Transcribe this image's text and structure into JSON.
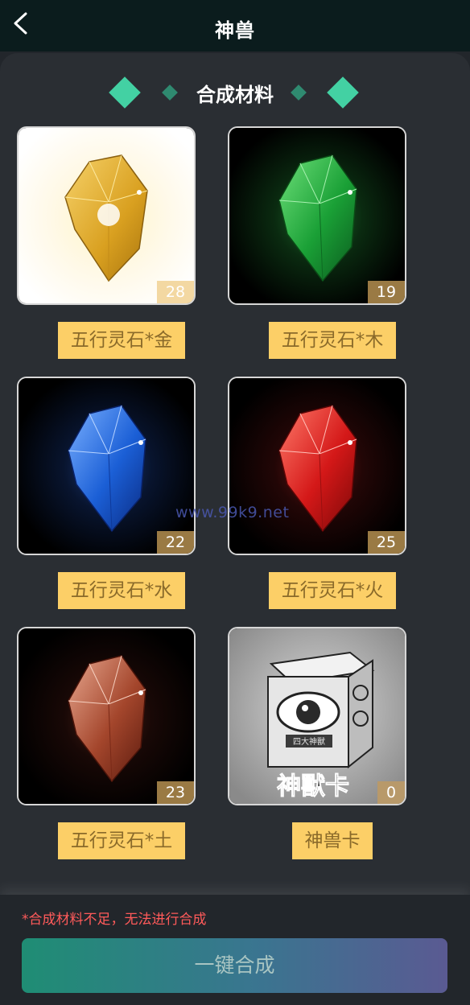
{
  "header": {
    "title": "神兽"
  },
  "section": {
    "title": "合成材料"
  },
  "materials": [
    {
      "name": "五行灵石*金",
      "count": "28",
      "color": "#e8b530"
    },
    {
      "name": "五行灵石*木",
      "count": "19",
      "color": "#1fa83c"
    },
    {
      "name": "五行灵石*水",
      "count": "22",
      "color": "#1b5fd6"
    },
    {
      "name": "五行灵石*火",
      "count": "25",
      "color": "#d41818"
    },
    {
      "name": "五行灵石*土",
      "count": "23",
      "color": "#a4462c"
    },
    {
      "name": "神兽卡",
      "count": "0",
      "card_text": "神獸卡",
      "box_label": "四大神獸"
    }
  ],
  "watermark": "www.99k9.net",
  "footer": {
    "notice": "*合成材料不足，无法进行合成",
    "button_label": "一键合成"
  },
  "colors": {
    "accent_green": "#43d1a3",
    "label_bg": "#fccf67",
    "count_bg": "#9a7a44",
    "notice": "#ff5a5a"
  }
}
